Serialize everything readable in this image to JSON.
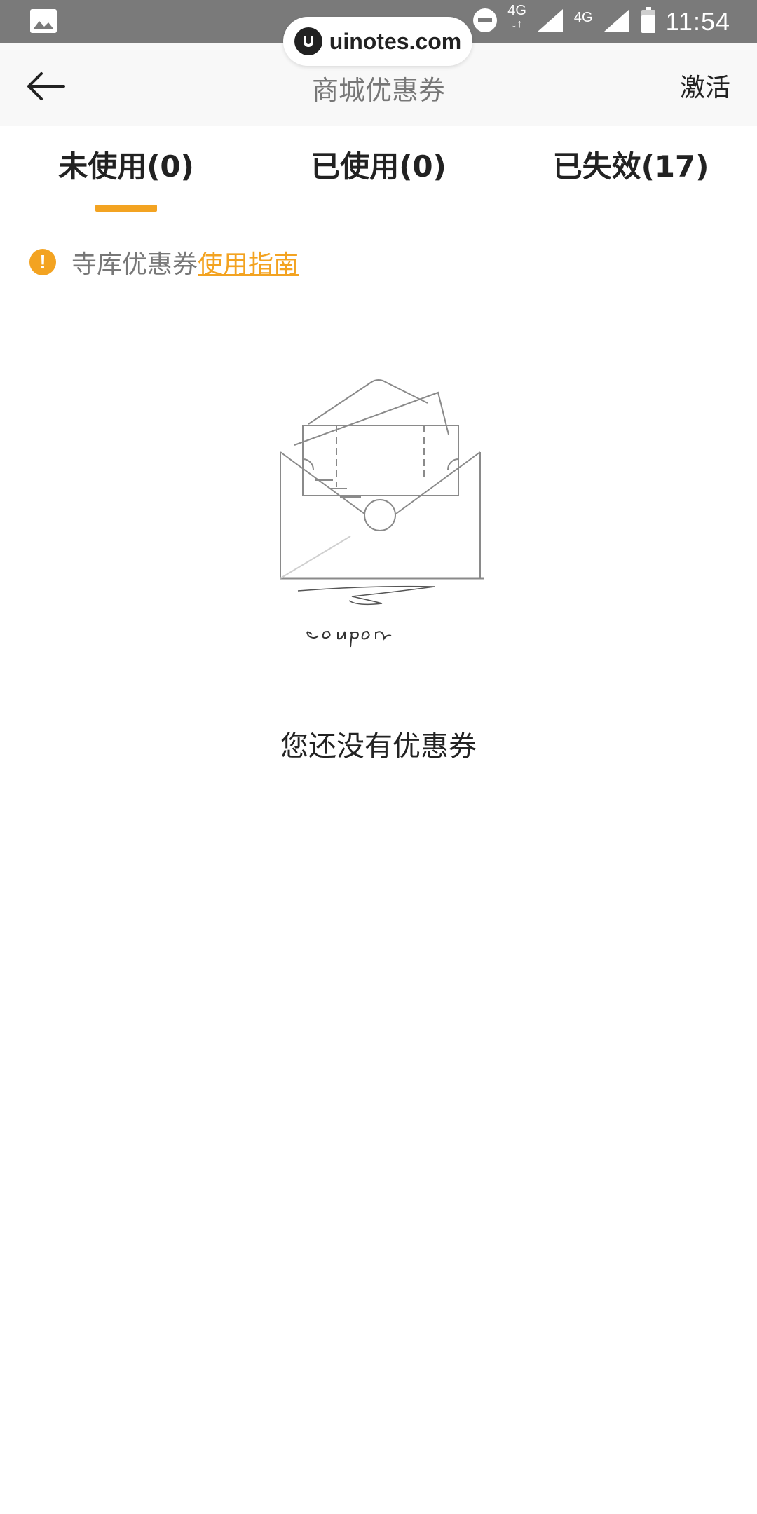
{
  "status_bar": {
    "time": "11:54",
    "network_1": "4G",
    "network_2": "4G"
  },
  "watermark": {
    "text": "uinotes.com"
  },
  "header": {
    "title": "商城优惠券",
    "activate_label": "激活"
  },
  "tabs": [
    {
      "label": "未使用(0)",
      "active": true
    },
    {
      "label": "已使用(0)",
      "active": false
    },
    {
      "label": "已失效(17)",
      "active": false
    }
  ],
  "notice": {
    "text": "寺库优惠券",
    "link": "使用指南"
  },
  "illustration": {
    "caption": "coupon"
  },
  "empty": {
    "message": "您还没有优惠券"
  },
  "colors": {
    "accent": "#f3a321",
    "status_bar": "#7a7a7a",
    "header_bg": "#f8f8f8"
  },
  "icons": {
    "back": "arrow-left-icon",
    "notice": "exclamation-circle-icon",
    "gallery": "image-icon"
  }
}
